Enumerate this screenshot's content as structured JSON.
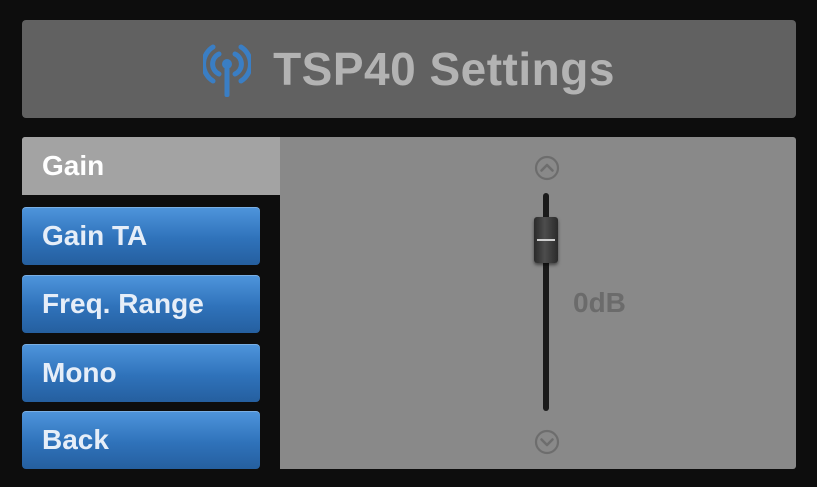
{
  "header": {
    "title": "TSP40 Settings",
    "icon": "antenna-icon"
  },
  "tab": {
    "label": "Gain"
  },
  "menu": {
    "items": [
      {
        "label": "Gain TA"
      },
      {
        "label": "Freq. Range"
      },
      {
        "label": "Mono"
      },
      {
        "label": "Back"
      }
    ]
  },
  "slider": {
    "value_label": "0dB",
    "level": 0.86,
    "up_icon": "chevron-up-icon",
    "down_icon": "chevron-down-icon"
  },
  "colors": {
    "accent": "#3a80c8",
    "header_bg": "#616161",
    "panel_bg": "#898989"
  }
}
